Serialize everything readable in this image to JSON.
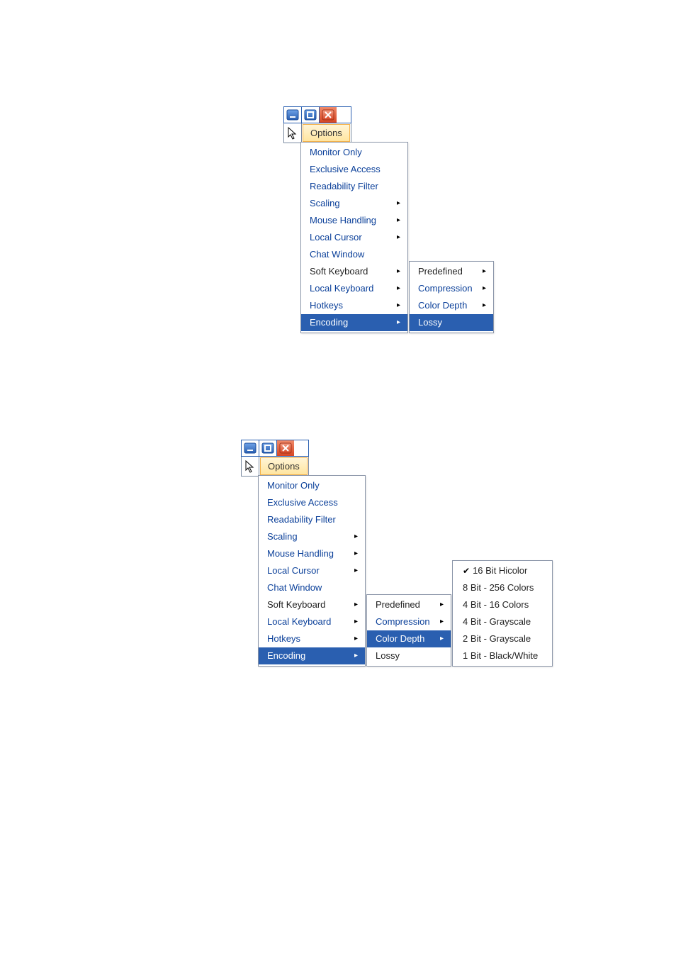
{
  "shared": {
    "options_label": "Options",
    "main_menu": {
      "monitor_only": "Monitor Only",
      "exclusive_access": "Exclusive Access",
      "readability_filter": "Readability Filter",
      "scaling": "Scaling",
      "mouse_handling": "Mouse Handling",
      "local_cursor": "Local Cursor",
      "chat_window": "Chat Window",
      "soft_keyboard": "Soft Keyboard",
      "local_keyboard": "Local Keyboard",
      "hotkeys": "Hotkeys",
      "encoding": "Encoding"
    },
    "encoding_submenu": {
      "predefined": "Predefined",
      "compression": "Compression",
      "color_depth": "Color Depth",
      "lossy": "Lossy"
    },
    "color_depth_submenu": {
      "bit16": "16 Bit Hicolor",
      "bit8": "8 Bit - 256 Colors",
      "bit4": "4 Bit - 16 Colors",
      "bit4g": "4 Bit - Grayscale",
      "bit2g": "2 Bit - Grayscale",
      "bit1": "1 Bit - Black/White"
    },
    "arrow": "▸"
  }
}
